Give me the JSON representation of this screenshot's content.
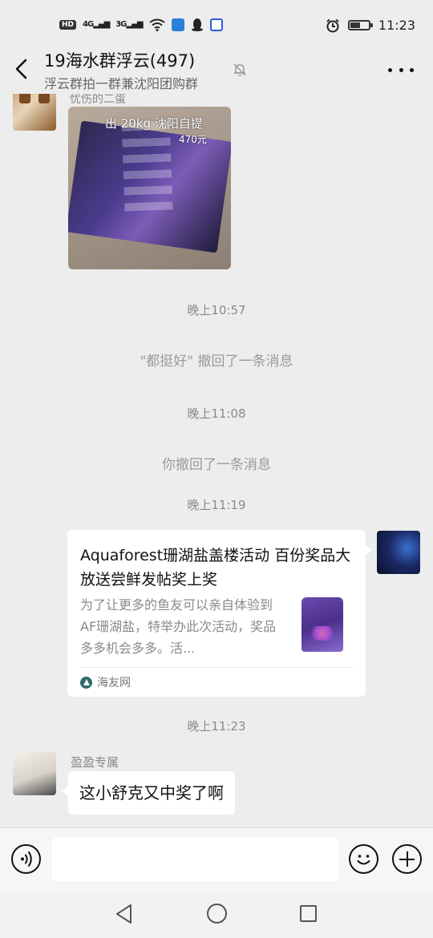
{
  "status_bar": {
    "network_badge": "HD",
    "signal_1": "4G",
    "signal_2": "3G",
    "time": "11:23",
    "battery_level": 0.55
  },
  "header": {
    "title": "19海水群浮云(497)",
    "subtitle": "浮云群拍一群兼沈阳团购群"
  },
  "messages": {
    "first": {
      "sender_name": "忧伤的二蛋",
      "image_caption": "出 20kg 沈阳自提",
      "image_price": "470元"
    },
    "time_1": "晚上10:57",
    "recall_1": "\"都挺好\" 撤回了一条消息",
    "time_2": "晚上11:08",
    "recall_2": "你撤回了一条消息",
    "time_3": "晚上11:19",
    "link_card": {
      "title": "Aquaforest珊湖盐盖楼活动 百份奖品大放送尝鲜发帖奖上奖",
      "description": "为了让更多的鱼友可以亲自体验到AF珊湖盐，特举办此次活动，奖品多多机会多多。活...",
      "source": "海友网"
    },
    "time_4": "晚上11:23",
    "last": {
      "sender_name": "盈盈专属",
      "text": "这小舒克又中奖了啊"
    }
  },
  "input_bar": {
    "placeholder": ""
  }
}
